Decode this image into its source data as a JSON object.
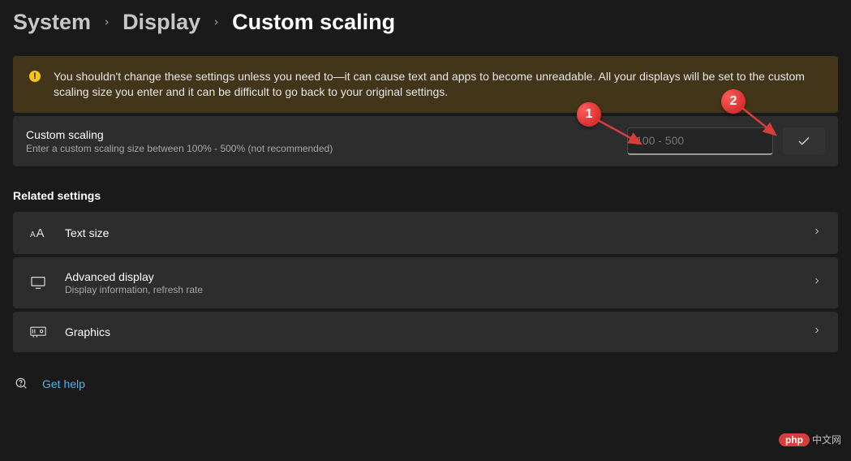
{
  "breadcrumb": {
    "system": "System",
    "display": "Display",
    "current": "Custom scaling"
  },
  "warning": {
    "icon": "!",
    "text": "You shouldn't change these settings unless you need to—it can cause text and apps to become unreadable. All your displays will be set to the custom scaling size you enter and it can be difficult to go back to your original settings."
  },
  "scaling": {
    "title": "Custom scaling",
    "subtitle": "Enter a custom scaling size between 100% - 500% (not recommended)",
    "placeholder": "100 - 500"
  },
  "related_header": "Related settings",
  "related": [
    {
      "title": "Text size",
      "subtitle": ""
    },
    {
      "title": "Advanced display",
      "subtitle": "Display information, refresh rate"
    },
    {
      "title": "Graphics",
      "subtitle": ""
    }
  ],
  "help": {
    "label": "Get help"
  },
  "callouts": {
    "one": "1",
    "two": "2"
  },
  "watermark": {
    "php": "php",
    "cn": "中文网"
  }
}
